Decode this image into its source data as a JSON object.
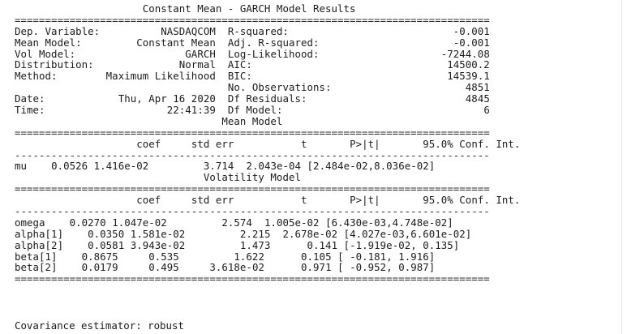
{
  "report": {
    "title": "Constant Mean - GARCH Model Results",
    "model_info": [
      {
        "label": "Dep. Variable:",
        "value": "NASDAQCOM",
        "stat_label": "R-squared:",
        "stat_value": "-0.001"
      },
      {
        "label": "Mean Model:",
        "value": "Constant Mean",
        "stat_label": "Adj. R-squared:",
        "stat_value": "-0.001"
      },
      {
        "label": "Vol Model:",
        "value": "GARCH",
        "stat_label": "Log-Likelihood:",
        "stat_value": "-7244.08"
      },
      {
        "label": "Distribution:",
        "value": "Normal",
        "stat_label": "AIC:",
        "stat_value": "14500.2"
      },
      {
        "label": "Method:",
        "value": "Maximum Likelihood",
        "stat_label": "BIC:",
        "stat_value": "14539.1"
      },
      {
        "label": "",
        "value": "",
        "stat_label": "No. Observations:",
        "stat_value": "4851"
      },
      {
        "label": "Date:",
        "value": "Thu, Apr 16 2020",
        "stat_label": "Df Residuals:",
        "stat_value": "4845"
      },
      {
        "label": "Time:",
        "value": "22:41:39",
        "stat_label": "Df Model:",
        "stat_value": "6"
      }
    ],
    "columns": [
      "coef",
      "std err",
      "t",
      "P>|t|",
      "95.0% Conf. Int."
    ],
    "mean_model": {
      "title": "Mean Model",
      "rows": [
        {
          "name": "mu",
          "coef": "0.0526",
          "std_err": "1.416e-02",
          "t": "3.714",
          "p": "2.043e-04",
          "ci": "[2.484e-02,8.036e-02]"
        }
      ]
    },
    "volatility_model": {
      "title": "Volatility Model",
      "rows": [
        {
          "name": "omega",
          "coef": "0.0270",
          "std_err": "1.047e-02",
          "t": "2.574",
          "p": "1.005e-02",
          "ci": "[6.430e-03,4.748e-02]"
        },
        {
          "name": "alpha[1]",
          "coef": "0.0350",
          "std_err": "1.581e-02",
          "t": "2.215",
          "p": "2.678e-02",
          "ci": "[4.027e-03,6.601e-02]"
        },
        {
          "name": "alpha[2]",
          "coef": "0.0581",
          "std_err": "3.943e-02",
          "t": "1.473",
          "p": "0.141",
          "ci": "[-1.919e-02, 0.135]"
        },
        {
          "name": "beta[1]",
          "coef": "0.8675",
          "std_err": "0.535",
          "t": "1.622",
          "p": "0.105",
          "ci": "[ -0.181, 1.916]"
        },
        {
          "name": "beta[2]",
          "coef": "0.0179",
          "std_err": "0.495",
          "t": "3.618e-02",
          "p": "0.971",
          "ci": "[ -0.952, 0.987]"
        }
      ]
    },
    "covariance_label": "Covariance estimator:",
    "covariance_value": "robust"
  }
}
